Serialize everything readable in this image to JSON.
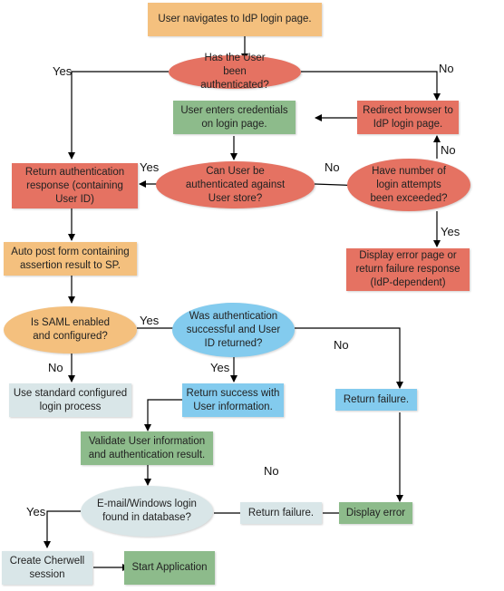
{
  "nodes": {
    "start": "User navigates to IdP login page.",
    "authenticated_q": "Has the User been authenticated?",
    "redirect": "Redirect browser to IdP login page.",
    "enter_credentials": "User enters credentials on login page.",
    "can_authenticate_q": "Can User be authenticated against User store?",
    "attempts_exceeded_q": "Have number of login attempts been exceeded?",
    "return_auth_response": "Return authentication response (containing User ID)",
    "display_error_page": "Display error page or return failure response (IdP-dependent)",
    "auto_post": "Auto post form containing assertion result to SP.",
    "saml_enabled_q": "Is SAML enabled and configured?",
    "auth_successful_q": "Was authentication successful and User ID returned?",
    "standard_login": "Use standard configured login process",
    "return_success": "Return success with User information.",
    "return_failure_1": "Return failure.",
    "validate": "Validate User information and authentication result.",
    "login_found_q": "E-mail/Windows login found in database?",
    "return_failure_2": "Return failure.",
    "display_error": "Display error",
    "create_session": "Create Cherwell session",
    "start_app": "Start Application"
  },
  "labels": {
    "yes_authenticated": "Yes",
    "no_authenticated": "No",
    "yes_can_auth": "Yes",
    "no_can_auth": "No",
    "no_attempts": "No",
    "yes_attempts": "Yes",
    "yes_saml": "Yes",
    "no_saml": "No",
    "yes_success": "Yes",
    "no_success": "No",
    "no_login_found": "No",
    "yes_login_found": "Yes"
  },
  "colors": {
    "orange": "#f4c07e",
    "red": "#e57262",
    "green": "#8dbb8b",
    "blue": "#83cbee",
    "grey": "#d9e6e8"
  }
}
